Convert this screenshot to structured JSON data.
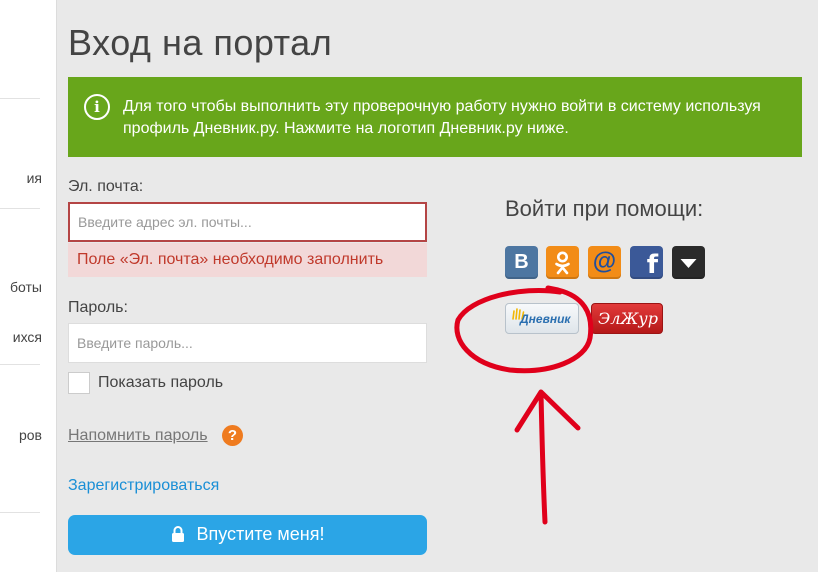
{
  "sidebar": {
    "fragments": [
      "ия",
      "боты",
      "ихся",
      "ров"
    ]
  },
  "page": {
    "title": "Вход на портал"
  },
  "notice": {
    "icon": "info-icon",
    "text": "Для того чтобы выполнить эту проверочную работу нужно войти в систему используя профиль Дневник.ру. Нажмите на логотип Дневник.ру ниже.",
    "color": "#68a61b"
  },
  "form": {
    "email": {
      "label": "Эл. почта:",
      "placeholder": "Введите адрес эл. почты...",
      "value": "",
      "error": "Поле «Эл. почта» необходимо заполнить"
    },
    "password": {
      "label": "Пароль:",
      "placeholder": "Введите пароль...",
      "value": ""
    },
    "show_password": {
      "label": "Показать пароль",
      "checked": false
    },
    "remind_password": "Напомнить пароль",
    "help": "?",
    "register": "Зарегистрироваться",
    "submit": "Впустите меня!"
  },
  "social": {
    "title": "Войти при помощи:",
    "providers": [
      {
        "icon": "vk-icon",
        "label": "В",
        "color": "#4d76a1"
      },
      {
        "icon": "odnoklassniki-icon",
        "color": "#f28c17"
      },
      {
        "icon": "mailru-icon",
        "label": "@",
        "color": "#f28c17"
      },
      {
        "icon": "facebook-icon",
        "label": "f",
        "color": "#3b5998"
      },
      {
        "icon": "more-dropdown-icon",
        "color": "#2a2a2a"
      }
    ],
    "dnevnik_label": "Дневник",
    "eljur_label": "ЭлЖур"
  },
  "colors": {
    "accent_blue": "#2ba5e6",
    "link_blue": "#1a8fd6",
    "error_red": "#c0392b",
    "annotation_red": "#e0001b"
  }
}
